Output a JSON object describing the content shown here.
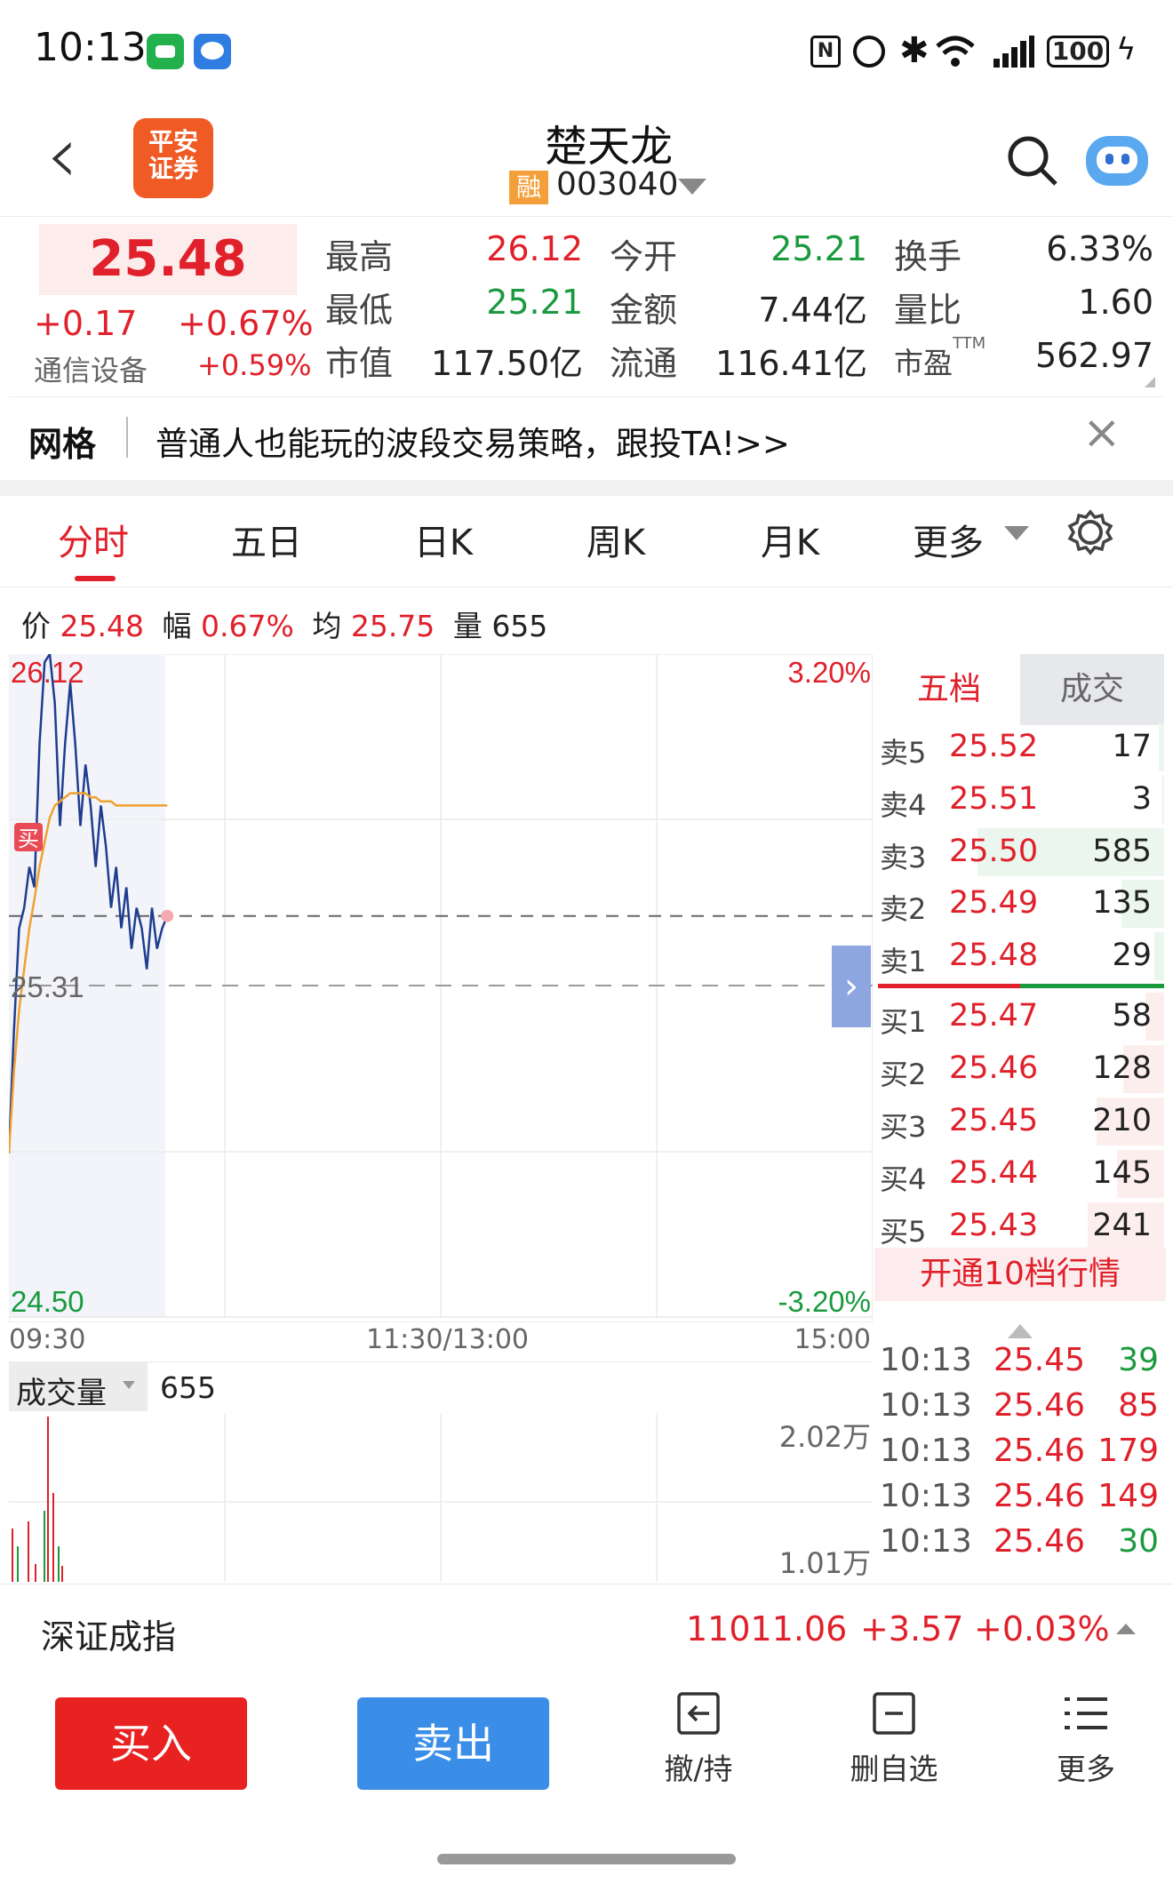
{
  "status_bar": {
    "time": "10:13",
    "battery": "100"
  },
  "header": {
    "back": "‹",
    "broker_logo_line1": "平安",
    "broker_logo_line2": "证券",
    "stock_name": "楚天龙",
    "margin_badge": "融",
    "stock_code": "003040"
  },
  "quote": {
    "price": "25.48",
    "change": "+0.17",
    "change_pct": "+0.67%",
    "sector": "通信设备",
    "sector_pct": "+0.59%",
    "fields": [
      {
        "label": "最高",
        "value": "26.12",
        "tone": "red"
      },
      {
        "label": "今开",
        "value": "25.21",
        "tone": "green"
      },
      {
        "label": "换手",
        "value": "6.33%",
        "tone": "dark"
      },
      {
        "label": "最低",
        "value": "25.21",
        "tone": "green"
      },
      {
        "label": "金额",
        "value": "7.44亿",
        "tone": "dark"
      },
      {
        "label": "量比",
        "value": "1.60",
        "tone": "dark"
      },
      {
        "label": "市值",
        "value": "117.50亿",
        "tone": "dark"
      },
      {
        "label": "流通",
        "value": "116.41亿",
        "tone": "dark"
      },
      {
        "label": "市盈",
        "value": "562.97",
        "tone": "dark"
      }
    ],
    "pe_sup": "TTM"
  },
  "banner": {
    "tag": "网格",
    "text": "普通人也能玩的波段交易策略，跟投TA!>>"
  },
  "tabs": [
    "分时",
    "五日",
    "日K",
    "周K",
    "月K",
    "更多"
  ],
  "active_tab": "分时",
  "chart_info": {
    "price_label": "价",
    "price": "25.48",
    "amp_label": "幅",
    "amp": "0.67%",
    "avg_label": "均",
    "avg": "25.75",
    "vol_label": "量",
    "vol": "655"
  },
  "chart_data": {
    "type": "line",
    "title": "",
    "y_top": "26.12",
    "y_mid": "25.31",
    "y_bottom": "24.50",
    "pct_top": "3.20%",
    "pct_bottom": "-3.20%",
    "x_labels": [
      "09:30",
      "11:30/13:00",
      "15:00"
    ],
    "ylim": [
      24.5,
      26.12
    ],
    "prev_close": 25.31,
    "series": [
      {
        "values": [
          24.9,
          25.2,
          25.45,
          25.5,
          25.6,
          25.55,
          25.9,
          26.1,
          26.12,
          26.0,
          25.7,
          25.9,
          26.05,
          25.9,
          25.7,
          25.85,
          25.75,
          25.6,
          25.75,
          25.65,
          25.5,
          25.6,
          25.45,
          25.55,
          25.4,
          25.5,
          25.45,
          25.35,
          25.5,
          25.4,
          25.45,
          25.48
        ]
      },
      {
        "values": [
          24.9,
          25.1,
          25.25,
          25.35,
          25.45,
          25.52,
          25.6,
          25.66,
          25.72,
          25.75,
          25.76,
          25.77,
          25.78,
          25.78,
          25.78,
          25.78,
          25.77,
          25.77,
          25.76,
          25.76,
          25.76,
          25.75,
          25.75,
          25.75,
          25.75,
          25.75,
          25.75,
          25.75,
          25.75,
          25.75,
          25.75,
          25.75
        ]
      }
    ],
    "buy_marker": "买"
  },
  "orderbook": {
    "tab_active": "五档",
    "tab_other": "成交",
    "sells": [
      {
        "label": "卖5",
        "price": "25.52",
        "vol": "17",
        "bar": 0.03
      },
      {
        "label": "卖4",
        "price": "25.51",
        "vol": "3",
        "bar": 0.01
      },
      {
        "label": "卖3",
        "price": "25.50",
        "vol": "585",
        "bar": 1.0
      },
      {
        "label": "卖2",
        "price": "25.49",
        "vol": "135",
        "bar": 0.23
      },
      {
        "label": "卖1",
        "price": "25.48",
        "vol": "29",
        "bar": 0.05
      }
    ],
    "buys": [
      {
        "label": "买1",
        "price": "25.47",
        "vol": "58",
        "bar": 0.1
      },
      {
        "label": "买2",
        "price": "25.46",
        "vol": "128",
        "bar": 0.22
      },
      {
        "label": "买3",
        "price": "25.45",
        "vol": "210",
        "bar": 0.36
      },
      {
        "label": "买4",
        "price": "25.44",
        "vol": "145",
        "bar": 0.25
      },
      {
        "label": "买5",
        "price": "25.43",
        "vol": "241",
        "bar": 0.41
      }
    ],
    "upgrade": "开通10档行情"
  },
  "ticks": [
    {
      "time": "10:13",
      "price": "25.45",
      "vol": "39",
      "tone": "green"
    },
    {
      "time": "10:13",
      "price": "25.46",
      "vol": "85",
      "tone": "red"
    },
    {
      "time": "10:13",
      "price": "25.46",
      "vol": "179",
      "tone": "red"
    },
    {
      "time": "10:13",
      "price": "25.46",
      "vol": "149",
      "tone": "red"
    },
    {
      "time": "10:13",
      "price": "25.46",
      "vol": "30",
      "tone": "green"
    }
  ],
  "volume_panel": {
    "label": "成交量",
    "value": "655",
    "max": "2.02万",
    "mid": "1.01万"
  },
  "index_bar": {
    "name": "深证成指",
    "value": "11011.06",
    "change": "+3.57",
    "pct": "+0.03%"
  },
  "bottom": {
    "buy": "买入",
    "sell": "卖出",
    "cancel": "撤/持",
    "watch": "删自选",
    "more": "更多"
  },
  "colors": {
    "up": "#e0202a",
    "down": "#1a9a3e",
    "accent_buy": "#e82121",
    "accent_sell": "#3a8ee8"
  }
}
